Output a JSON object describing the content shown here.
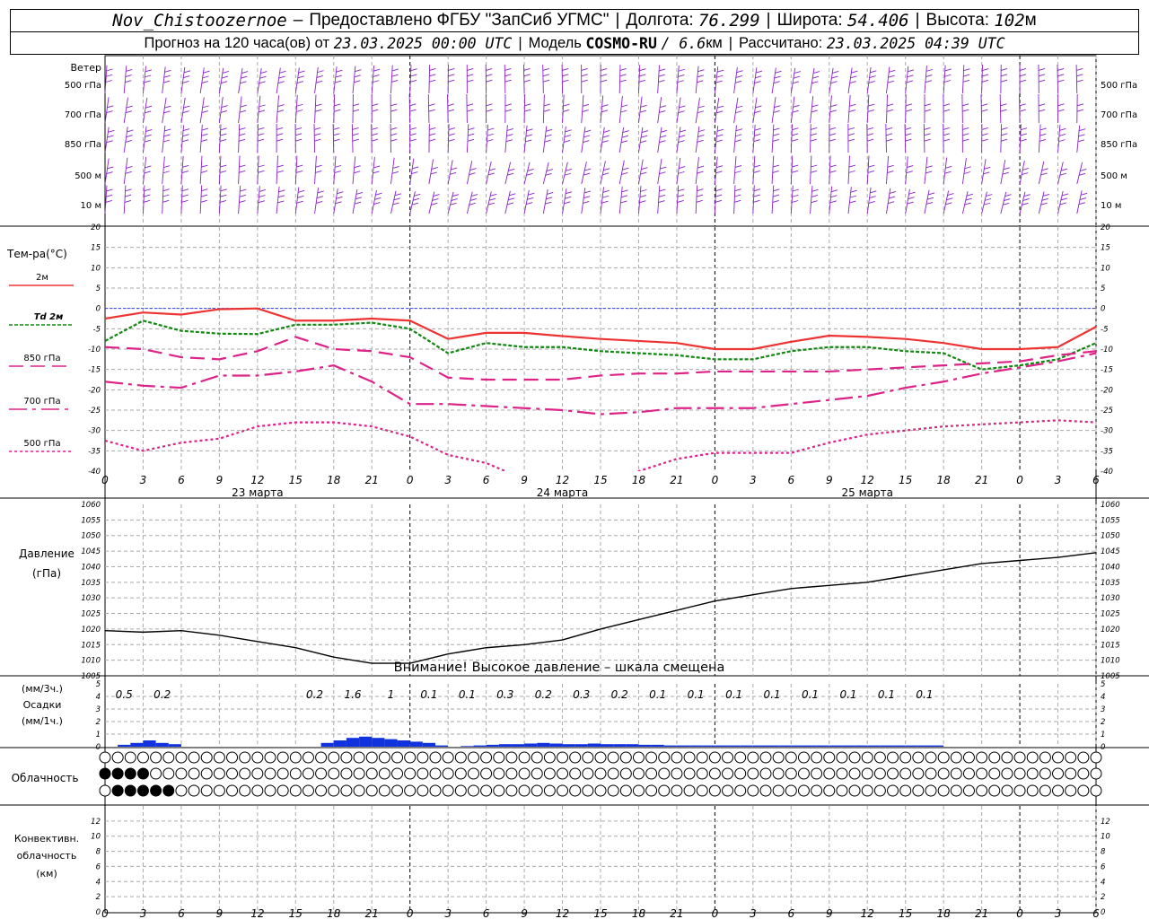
{
  "header": {
    "station": "Nov_Chistoozernoe",
    "dash": "–",
    "provider": "Предоставлено ФГБУ \"ЗапСиб УГМС\"",
    "lon_label": "Долгота:",
    "lon": "76.299",
    "lat_label": "Широта:",
    "lat": "54.406",
    "alt_label": "Высота:",
    "alt": "102",
    "alt_unit": "м",
    "forecast_label": "Прогноз на 120 часа(ов) от",
    "forecast_start": "23.03.2025 00:00 UTC",
    "model_label": "Модель",
    "model": "COSMO-RU",
    "resolution": "/ 6.6",
    "resolution_unit": "км",
    "calc_label": "Рассчитано:",
    "calc_time": "23.03.2025 04:39 UTC"
  },
  "colors": {
    "t2m": "#ee3333",
    "td2m": "#118811",
    "t850": "#dd2288",
    "t700": "#dd2288",
    "t500": "#dd2288",
    "zero_line": "#3344ee",
    "wind": "#8822cc",
    "precip": "#1133dd",
    "conv": "#ee7722",
    "pressure": "#000000",
    "grid": "#aaaaaa"
  },
  "chart_data": [
    {
      "type": "wind_barbs",
      "title": "Ветер",
      "levels": [
        "500 гПа",
        "700 гПа",
        "850 гПа",
        "500 м",
        "10 м"
      ]
    },
    {
      "type": "line",
      "ylabel": "Тем-ра(°C)",
      "ylim": [
        -40,
        20
      ],
      "yticks": [
        20,
        15,
        10,
        5,
        0,
        -5,
        -10,
        -15,
        -20,
        -25,
        -30,
        -35,
        -40
      ],
      "xticks": [
        "0",
        "3",
        "6",
        "9",
        "12",
        "15",
        "18",
        "21",
        "0",
        "3",
        "6",
        "9",
        "12",
        "15",
        "18",
        "21",
        "0",
        "3",
        "6",
        "9",
        "12",
        "15",
        "18",
        "21",
        "0",
        "3",
        "6"
      ],
      "day_labels": [
        "23 марта",
        "24 марта",
        "25 марта"
      ],
      "x_hours": [
        0,
        3,
        6,
        9,
        12,
        15,
        18,
        21,
        24,
        27,
        30,
        33,
        36,
        39,
        42,
        45,
        48,
        51,
        54,
        57,
        60,
        63,
        66,
        69,
        72,
        75,
        78
      ],
      "series": [
        {
          "name": "2м",
          "values": [
            -2.5,
            -1,
            -1.5,
            -0.2,
            0,
            -3,
            -3,
            -2.5,
            -3,
            -7.5,
            -6,
            -6,
            -6.8,
            -7.5,
            -8,
            -8.5,
            -10,
            -10,
            -8.2,
            -6.7,
            -7,
            -7.5,
            -8.5,
            -10,
            -10,
            -9.5,
            -4.5
          ]
        },
        {
          "name": "Td 2м",
          "values": [
            -8,
            -3,
            -5.5,
            -6.2,
            -6.3,
            -4,
            -4,
            -3.5,
            -5,
            -11,
            -8.5,
            -9.5,
            -9.5,
            -10.5,
            -11,
            -11.5,
            -12.5,
            -12.5,
            -10.5,
            -9.5,
            -9.5,
            -10.5,
            -11,
            -15,
            -14,
            -12.5,
            -8.5
          ]
        },
        {
          "name": "850 гПа",
          "values": [
            -9.5,
            -10,
            -12,
            -12.5,
            -10.5,
            -7,
            -10,
            -10.5,
            -12,
            -17,
            -17.5,
            -17.5,
            -17.5,
            -16.5,
            -16,
            -16,
            -15.5,
            -15.5,
            -15.5,
            -15.5,
            -15,
            -14.5,
            -14,
            -13.5,
            -13,
            -11.5,
            -10.5
          ]
        },
        {
          "name": "700 гПа",
          "values": [
            -18,
            -19,
            -19.5,
            -16.5,
            -16.5,
            -15.5,
            -14,
            -18,
            -23.5,
            -23.5,
            -24,
            -24.5,
            -25,
            -26,
            -25.5,
            -24.5,
            -24.5,
            -24.5,
            -23.5,
            -22.5,
            -21.5,
            -19.5,
            -18,
            -16,
            -14.5,
            -13,
            -11
          ]
        },
        {
          "name": "500 гПа",
          "values": [
            -32.5,
            -35,
            -33,
            -32,
            -29,
            -28,
            -28,
            -29,
            -31.5,
            -36,
            -38,
            -42,
            -44,
            -43,
            -40,
            -37,
            -35.5,
            -35.5,
            -35.5,
            -33,
            -31,
            -30,
            -29,
            -28.5,
            -28,
            -27.5,
            -28
          ]
        }
      ]
    },
    {
      "type": "line",
      "ylabel": "Давление",
      "ylabel2": "(гПа)",
      "ylim": [
        1005,
        1060
      ],
      "yticks": [
        1060,
        1055,
        1050,
        1045,
        1040,
        1035,
        1030,
        1025,
        1020,
        1015,
        1010,
        1005
      ],
      "annotation": "Внимание! Высокое давление – шкала смещена",
      "x_hours": [
        0,
        3,
        6,
        9,
        12,
        15,
        18,
        21,
        24,
        27,
        30,
        33,
        36,
        39,
        42,
        45,
        48,
        51,
        54,
        57,
        60,
        63,
        66,
        69,
        72,
        75,
        78
      ],
      "values": [
        1019.5,
        1019,
        1019.5,
        1018,
        1016,
        1014,
        1011,
        1009,
        1009,
        1012,
        1014,
        1015,
        1016.5,
        1020,
        1023,
        1026,
        1029,
        1031,
        1033,
        1034,
        1035,
        1037,
        1039,
        1041,
        1042,
        1043,
        1044.5
      ]
    },
    {
      "type": "bar",
      "ylabel1": "(мм/3ч.)",
      "ylabel2": "Осадки",
      "ylabel3": "(мм/1ч.)",
      "ylim": [
        0,
        5
      ],
      "yticks": [
        5,
        4,
        3,
        2,
        1,
        0
      ],
      "sum_labels": [
        {
          "hour": 1.5,
          "text": "0.5"
        },
        {
          "hour": 4.5,
          "text": "0.2"
        },
        {
          "hour": 16.5,
          "text": "0.2"
        },
        {
          "hour": 19.5,
          "text": "1.6"
        },
        {
          "hour": 22.5,
          "text": "1"
        },
        {
          "hour": 25.5,
          "text": "0.1"
        },
        {
          "hour": 28.5,
          "text": "0.1"
        },
        {
          "hour": 31.5,
          "text": "0.3"
        },
        {
          "hour": 34.5,
          "text": "0.2"
        },
        {
          "hour": 37.5,
          "text": "0.3"
        },
        {
          "hour": 40.5,
          "text": "0.2"
        },
        {
          "hour": 43.5,
          "text": "0.1"
        },
        {
          "hour": 46.5,
          "text": "0.1"
        },
        {
          "hour": 49.5,
          "text": "0.1"
        },
        {
          "hour": 52.5,
          "text": "0.1"
        },
        {
          "hour": 55.5,
          "text": "0.1"
        },
        {
          "hour": 58.5,
          "text": "0.1"
        },
        {
          "hour": 61.5,
          "text": "0.1"
        },
        {
          "hour": 64.5,
          "text": "0.1"
        }
      ],
      "hourly": [
        0,
        0.15,
        0.3,
        0.5,
        0.3,
        0.2,
        0,
        0,
        0,
        0,
        0,
        0,
        0,
        0,
        0,
        0,
        0,
        0.3,
        0.5,
        0.7,
        0.8,
        0.7,
        0.6,
        0.5,
        0.4,
        0.3,
        0.1,
        0,
        0.05,
        0.1,
        0.15,
        0.2,
        0.2,
        0.25,
        0.3,
        0.25,
        0.2,
        0.2,
        0.25,
        0.2,
        0.2,
        0.2,
        0.15,
        0.15,
        0.1,
        0.1,
        0.1,
        0.1,
        0.1,
        0.1,
        0.1,
        0.1,
        0.1,
        0.1,
        0.1,
        0.1,
        0.1,
        0.1,
        0.1,
        0.1,
        0.1,
        0.1,
        0.1,
        0.1,
        0.1,
        0.1,
        0,
        0,
        0,
        0,
        0,
        0,
        0,
        0,
        0,
        0,
        0,
        0,
        0
      ]
    },
    {
      "type": "table",
      "title": "Облачность",
      "rows": [
        [
          1,
          0,
          0,
          0,
          0,
          0,
          0,
          0,
          0,
          0,
          0,
          0,
          0,
          0,
          0,
          0,
          0,
          0,
          0,
          0,
          0,
          0,
          0,
          0,
          0,
          0,
          0,
          0,
          0,
          0,
          0,
          0,
          0,
          0,
          0,
          0,
          0,
          0,
          0,
          0,
          0,
          0,
          0,
          0,
          0,
          0,
          0,
          0,
          0,
          0,
          0,
          0,
          0,
          0,
          0,
          0,
          0,
          0,
          0,
          0,
          0,
          0,
          0,
          0,
          0,
          0,
          0,
          0,
          0,
          0,
          0,
          0,
          0,
          0,
          0,
          0,
          0,
          0,
          0,
          0,
          0
        ],
        [
          4,
          4,
          4,
          4,
          3,
          0,
          0,
          0,
          0,
          0,
          0,
          0,
          0,
          0,
          0,
          0,
          0,
          0,
          0,
          0,
          0,
          0,
          0,
          0,
          0,
          0,
          0,
          0,
          0,
          0,
          0,
          0,
          0,
          0,
          0,
          0,
          0,
          0,
          0,
          0,
          0,
          0,
          0,
          0,
          0,
          0,
          0,
          0,
          0,
          0,
          0,
          0,
          0,
          0,
          0,
          0,
          0,
          0,
          0,
          0,
          0,
          0,
          0,
          0,
          0,
          0,
          0,
          0,
          0,
          0,
          0,
          0,
          0,
          0,
          0,
          0,
          0,
          0,
          0,
          0,
          0
        ],
        [
          0,
          4,
          4,
          4,
          4,
          4,
          0,
          0,
          0,
          0,
          0,
          0,
          0,
          0,
          0,
          0,
          0,
          0,
          0,
          0,
          0,
          0,
          0,
          0,
          0,
          0,
          0,
          0,
          0,
          0,
          0,
          0,
          0,
          0,
          0,
          0,
          0,
          0,
          0,
          0,
          0,
          0,
          0,
          0,
          0,
          0,
          0,
          0,
          0,
          0,
          0,
          0,
          0,
          0,
          0,
          0,
          0,
          0,
          0,
          0,
          0,
          0,
          0,
          0,
          0,
          0,
          0,
          0,
          0,
          0,
          0,
          0,
          0,
          0,
          0,
          0,
          0,
          0,
          0,
          0,
          0
        ]
      ]
    },
    {
      "type": "bar",
      "ylabel1": "Конвективн.",
      "ylabel2": "облачность",
      "ylabel3": "(км)",
      "ylim": [
        0,
        14
      ],
      "yticks": [
        12,
        10,
        8,
        6,
        4,
        2,
        0
      ]
    }
  ]
}
